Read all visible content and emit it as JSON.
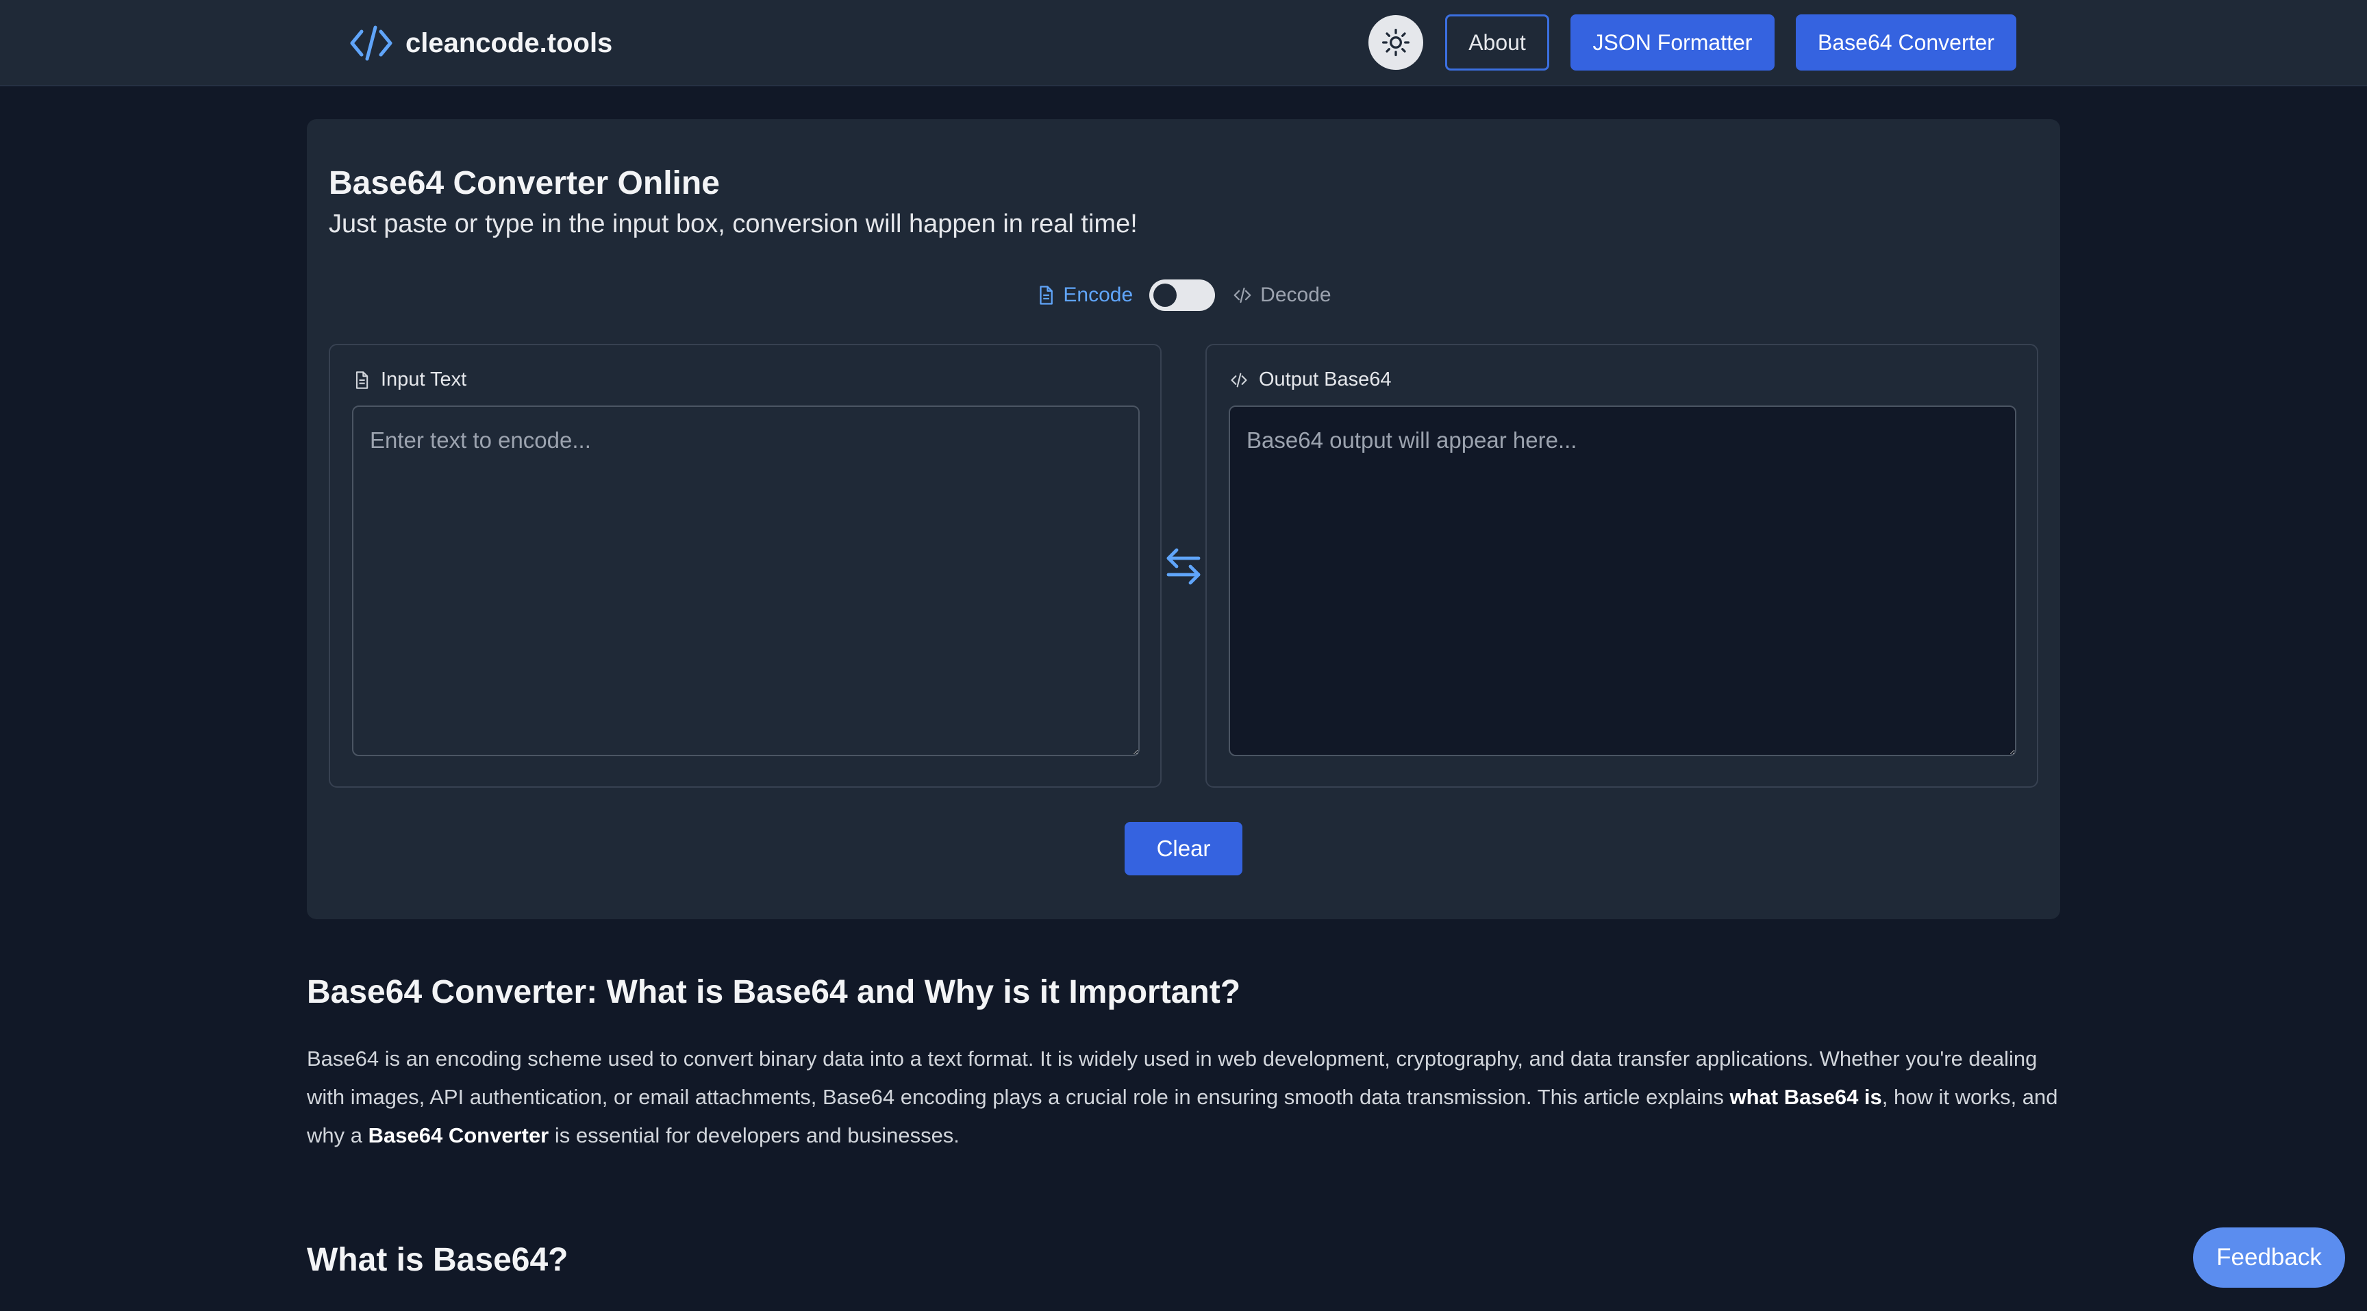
{
  "header": {
    "brand": "cleancode.tools",
    "nav": {
      "about": "About",
      "json_formatter": "JSON Formatter",
      "base64_converter": "Base64 Converter"
    }
  },
  "tool": {
    "title": "Base64 Converter Online",
    "subtitle": "Just paste or type in the input box, conversion will happen in real time!",
    "mode": {
      "encode_label": "Encode",
      "decode_label": "Decode",
      "selected": "Encode"
    },
    "input": {
      "label": "Input Text",
      "placeholder": "Enter text to encode...",
      "value": ""
    },
    "output": {
      "label": "Output Base64",
      "placeholder": "Base64 output will appear here...",
      "value": ""
    },
    "clear_label": "Clear"
  },
  "article": {
    "heading": "Base64 Converter: What is Base64 and Why is it Important?",
    "para_part1": "Base64 is an encoding scheme used to convert binary data into a text format. It is widely used in web development, cryptography, and data transfer applications. Whether you're dealing with images, API authentication, or email attachments, Base64 encoding plays a crucial role in ensuring smooth data transmission. This article explains ",
    "para_bold1": "what Base64 is",
    "para_part2": ", how it works, and why a ",
    "para_bold2": "Base64 Converter",
    "para_part3": " is essential for developers and businesses.",
    "heading2": "What is Base64?"
  },
  "feedback_label": "Feedback",
  "colors": {
    "background": "#111827",
    "surface": "#1f2937",
    "accent": "#3563e0",
    "link_blue": "#60a5fa",
    "feedback": "#5b8def"
  },
  "icons": {
    "brand": "code-brackets-icon",
    "theme": "sun-icon",
    "encode": "document-icon",
    "decode": "code-icon",
    "swap": "swap-arrows-icon"
  }
}
